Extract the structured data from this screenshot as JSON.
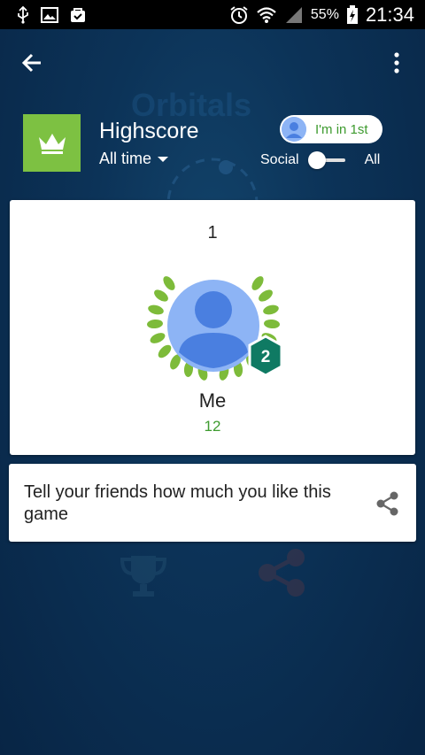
{
  "status_bar": {
    "battery_percent": "55%",
    "time": "21:34"
  },
  "background": {
    "game_logo_text": "Orbitals"
  },
  "header": {
    "title": "Highscore",
    "time_filter": "All time",
    "rank_badge": "I'm in 1st",
    "toggle_left": "Social",
    "toggle_right": "All"
  },
  "leaderboard": {
    "rank": "1",
    "player_name": "Me",
    "player_score": "12",
    "player_level": "2"
  },
  "share_card": {
    "text": "Tell your friends how much you like this game"
  },
  "colors": {
    "accent_green": "#3e9b2f",
    "game_icon_bg": "#7dc142",
    "level_badge": "#0f7a63"
  }
}
